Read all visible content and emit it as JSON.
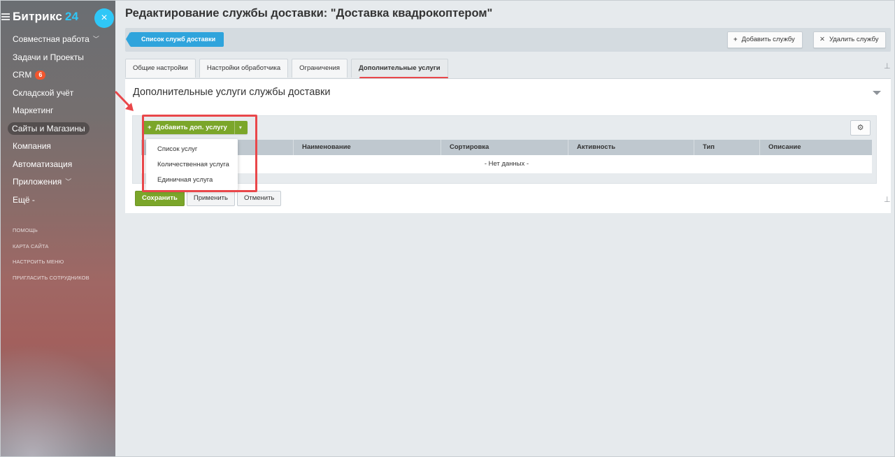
{
  "sidebar": {
    "logo_text": "Битрикс",
    "logo_num": "24",
    "close_glyph": "×",
    "items": [
      {
        "label": "Совместная работа",
        "chevron": true
      },
      {
        "label": "Задачи и Проекты"
      },
      {
        "label": "CRM",
        "badge": "6"
      },
      {
        "label": "Складской учёт"
      },
      {
        "label": "Маркетинг"
      },
      {
        "label": "Сайты и Магазины",
        "active": true
      },
      {
        "label": "Компания"
      },
      {
        "label": "Автоматизация"
      },
      {
        "label": "Приложения",
        "chevron": true
      },
      {
        "label": "Ещё -"
      }
    ],
    "small_links": [
      "ПОМОЩЬ",
      "КАРТА САЙТА",
      "НАСТРОИТЬ МЕНЮ",
      "ПРИГЛАСИТЬ СОТРУДНИКОВ"
    ]
  },
  "page": {
    "title": "Редактирование службы доставки: \"Доставка квадрокоптером\""
  },
  "toolbar": {
    "back_label": "Список служб доставки",
    "add_label": "Добавить службу",
    "add_icon": "plus-icon",
    "delete_label": "Удалить службу",
    "delete_icon": "close-icon"
  },
  "tabs": [
    {
      "label": "Общие настройки"
    },
    {
      "label": "Настройки обработчика"
    },
    {
      "label": "Ограничения"
    },
    {
      "label": "Дополнительные услуги",
      "active": true
    }
  ],
  "panel": {
    "title": "Дополнительные услуги службы доставки",
    "add_button_label": "Добавить доп. услугу",
    "columns": [
      "",
      "Наименование",
      "Сортировка",
      "Активность",
      "Тип",
      "Описание"
    ],
    "empty_text": "- Нет данных -",
    "dropdown_items": [
      "Список услуг",
      "Количественная услуга",
      "Единичная услуга"
    ]
  },
  "form_buttons": {
    "save": "Сохранить",
    "apply": "Применить",
    "cancel": "Отменить"
  },
  "colors": {
    "accent_blue": "#2fa4dc",
    "accent_green": "#7ba62a",
    "highlight_red": "#e9474a"
  }
}
